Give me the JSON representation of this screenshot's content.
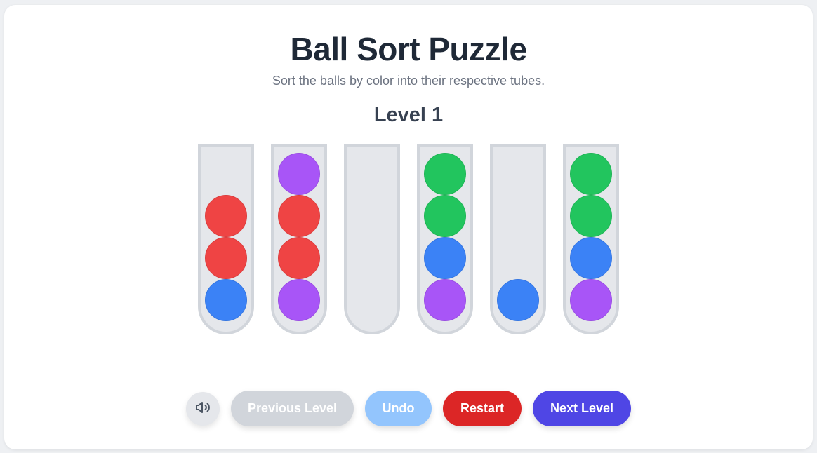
{
  "header": {
    "title": "Ball Sort Puzzle",
    "subtitle": "Sort the balls by color into their respective tubes.",
    "level_label": "Level 1"
  },
  "colors": {
    "red": "#ef4444",
    "purple": "#a855f7",
    "green": "#22c55e",
    "blue": "#3b82f6",
    "tube_fill": "#e5e7eb",
    "tube_border": "#d1d5db"
  },
  "board": {
    "tubes": [
      {
        "balls_bottom_to_top": [
          "blue",
          "red",
          "red"
        ]
      },
      {
        "balls_bottom_to_top": [
          "purple",
          "red",
          "red",
          "purple"
        ]
      },
      {
        "balls_bottom_to_top": []
      },
      {
        "balls_bottom_to_top": [
          "purple",
          "blue",
          "green",
          "green"
        ]
      },
      {
        "balls_bottom_to_top": [
          "blue"
        ]
      },
      {
        "balls_bottom_to_top": [
          "purple",
          "blue",
          "green",
          "green"
        ]
      }
    ]
  },
  "controls": {
    "sound_icon": "speaker-icon",
    "previous_label": "Previous Level",
    "previous_color": "#d1d5db",
    "undo_label": "Undo",
    "undo_color": "#93c5fd",
    "restart_label": "Restart",
    "restart_color": "#dc2626",
    "next_label": "Next Level",
    "next_color": "#4f46e5"
  }
}
